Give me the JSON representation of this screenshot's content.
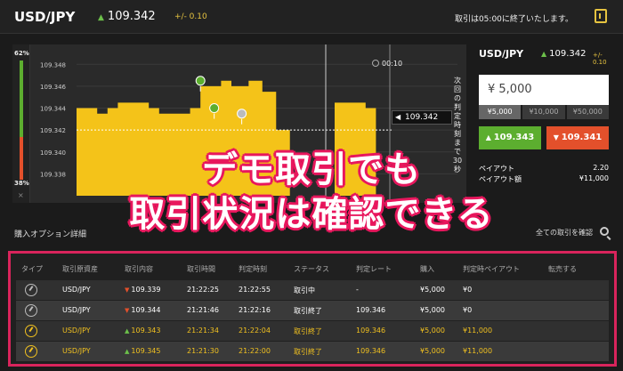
{
  "header": {
    "pair": "USD/JPY",
    "rate": "109.342",
    "change": "+/- 0.10",
    "notice": "取引は05:00に終了いたします。"
  },
  "chart": {
    "meter_top": "62%",
    "meter_bottom": "38%",
    "close_symbol": "×",
    "timer": "00:10",
    "side_label": "次回の判定時刻まで30秒",
    "current_rate": "109.342",
    "y_ticks": [
      "109.348",
      "109.346",
      "109.344",
      "109.342",
      "109.340",
      "109.338"
    ]
  },
  "chart_data": {
    "type": "area",
    "title": "",
    "xlabel": "",
    "ylabel": "",
    "ylim": [
      109.336,
      109.349
    ],
    "yticks": [
      109.338,
      109.34,
      109.342,
      109.344,
      109.346,
      109.348
    ],
    "series": [
      {
        "x": [
          0,
          6,
          12,
          18,
          24,
          30,
          36,
          42,
          48,
          54,
          60,
          66,
          72,
          78,
          84,
          90,
          96,
          100,
          104,
          108,
          112,
          116,
          120,
          124
        ],
        "values": [
          109.344,
          109.344,
          109.3435,
          109.344,
          109.3445,
          109.3445,
          109.3445,
          109.344,
          109.3435,
          109.3435,
          109.3435,
          109.344,
          109.346,
          109.346,
          109.3465,
          109.346,
          109.346,
          109.3465,
          109.3465,
          109.3455,
          109.3455,
          109.342,
          109.342,
          109.342
        ]
      },
      {
        "x": [
          150,
          156,
          162,
          168,
          174
        ],
        "values": [
          109.3445,
          109.3445,
          109.3445,
          109.344,
          109.344
        ]
      }
    ],
    "current": 109.342,
    "markers": [
      {
        "x": 72,
        "y": 109.3465,
        "type": "high"
      },
      {
        "x": 80,
        "y": 109.344,
        "type": "high"
      },
      {
        "x": 96,
        "y": 109.3435,
        "type": "low"
      }
    ]
  },
  "panel": {
    "pair": "USD/JPY",
    "rate": "109.342",
    "change": "+/- 0.10",
    "amount": "¥ 5,000",
    "presets": [
      "¥5,000",
      "¥10,000",
      "¥50,000"
    ],
    "high_rate": "109.343",
    "low_rate": "109.341",
    "payout_label": "ペイアウト",
    "payout_value": "2.20",
    "payout_amount_label": "ペイアウト額",
    "payout_amount_value": "¥11,000"
  },
  "overlay": {
    "line1": "デモ取引でも",
    "line2": "取引状況は確認できる"
  },
  "midbar": {
    "left": "購入オプション詳細",
    "right": "全ての取引を確認"
  },
  "table": {
    "headers": [
      "タイプ",
      "取引原資産",
      "取引内容",
      "取引時間",
      "判定時刻",
      "ステータス",
      "判定レート",
      "購入",
      "判定時ペイアウト",
      "転売する"
    ],
    "rows": [
      {
        "asset": "USD/JPY",
        "dir": "down",
        "rate": "109.339",
        "time": "21:22:25",
        "judge": "21:22:55",
        "status": "取引中",
        "judge_rate": "-",
        "buy": "¥5,000",
        "payout": "¥0",
        "win": false
      },
      {
        "asset": "USD/JPY",
        "dir": "down",
        "rate": "109.344",
        "time": "21:21:46",
        "judge": "21:22:16",
        "status": "取引終了",
        "judge_rate": "109.346",
        "buy": "¥5,000",
        "payout": "¥0",
        "win": false
      },
      {
        "asset": "USD/JPY",
        "dir": "up",
        "rate": "109.343",
        "time": "21:21:34",
        "judge": "21:22:04",
        "status": "取引終了",
        "judge_rate": "109.346",
        "buy": "¥5,000",
        "payout": "¥11,000",
        "win": true
      },
      {
        "asset": "USD/JPY",
        "dir": "up",
        "rate": "109.345",
        "time": "21:21:30",
        "judge": "21:22:00",
        "status": "取引終了",
        "judge_rate": "109.346",
        "buy": "¥5,000",
        "payout": "¥11,000",
        "win": true
      }
    ]
  },
  "colors": {
    "area": "#f4c319",
    "high": "#5cae2f",
    "low": "#e3502b",
    "highlight": "#d9245c"
  }
}
